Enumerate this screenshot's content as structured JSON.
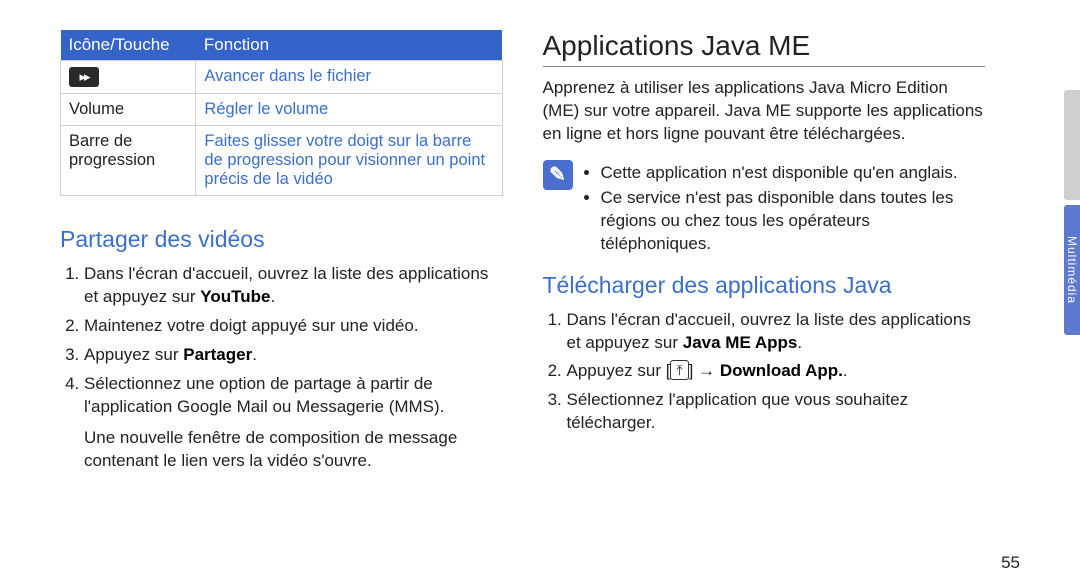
{
  "table": {
    "headers": {
      "icon": "Icône/Touche",
      "fn": "Fonction"
    },
    "rows": [
      {
        "icon_is_symbol": true,
        "icon_label": "▸▸",
        "fn": "Avancer dans le fichier"
      },
      {
        "icon_is_symbol": false,
        "icon_label": "Volume",
        "fn": "Régler le volume"
      },
      {
        "icon_is_symbol": false,
        "icon_label": "Barre de progression",
        "fn": "Faites glisser votre doigt sur la barre de progression pour visionner un point précis de la vidéo"
      }
    ]
  },
  "left": {
    "share_heading": "Partager des vidéos",
    "steps": [
      {
        "pre": "Dans l'écran d'accueil, ouvrez la liste des applications et appuyez sur ",
        "bold": "YouTube",
        "post": "."
      },
      {
        "pre": "Maintenez votre doigt appuyé sur une vidéo.",
        "bold": "",
        "post": ""
      },
      {
        "pre": "Appuyez sur ",
        "bold": "Partager",
        "post": "."
      },
      {
        "pre": "Sélectionnez une option de partage à partir de l'application Google Mail ou Messagerie (MMS).",
        "bold": "",
        "post": ""
      }
    ],
    "footer": "Une nouvelle fenêtre de composition de message contenant le lien vers la vidéo s'ouvre."
  },
  "right": {
    "heading": "Applications Java ME",
    "intro": "Apprenez à utiliser les applications Java Micro Edition (ME) sur votre appareil. Java ME supporte les applications en ligne et hors ligne pouvant être téléchargées.",
    "note_glyph": "✎",
    "notes": [
      "Cette application n'est disponible qu'en anglais.",
      "Ce service n'est pas disponible dans toutes les régions ou chez tous les opérateurs téléphoniques."
    ],
    "download_heading": "Télécharger des applications Java",
    "dl_steps": {
      "s1_pre": "Dans l'écran d'accueil, ouvrez la liste des applications et appuyez sur ",
      "s1_bold": "Java ME Apps",
      "s1_post": ".",
      "s2_pre": "Appuyez sur [",
      "s2_icon_glyph": "⤒",
      "s2_mid": "] → ",
      "s2_bold": "Download App.",
      "s2_post": ".",
      "s3": "Sélectionnez l'application que vous souhaitez télécharger."
    }
  },
  "page_number": "55",
  "side_label": "Multimédia"
}
